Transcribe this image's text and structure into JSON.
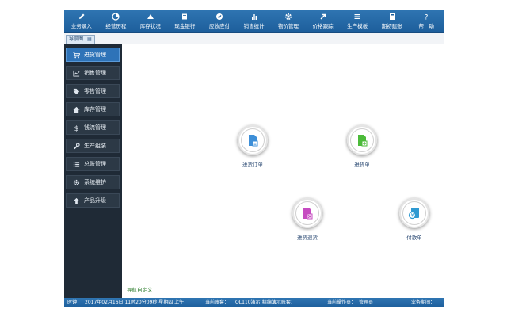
{
  "toolbar": {
    "items": [
      {
        "label": "业务录入",
        "icon": "pencil-icon"
      },
      {
        "label": "经营历程",
        "icon": "pie-chart-icon"
      },
      {
        "label": "库存状况",
        "icon": "cars-icon"
      },
      {
        "label": "现金银行",
        "icon": "book-icon"
      },
      {
        "label": "应收应付",
        "icon": "check-circle-icon"
      },
      {
        "label": "销售统计",
        "icon": "bar-chart-icon"
      },
      {
        "label": "物价管理",
        "icon": "gear-icon"
      },
      {
        "label": "价格跟踪",
        "icon": "arrow-icon"
      },
      {
        "label": "生产模板",
        "icon": "list-icon"
      },
      {
        "label": "期初建账",
        "icon": "calculator-icon"
      },
      {
        "label": "帮　助",
        "icon": "question-icon"
      }
    ]
  },
  "tabs": {
    "nav_label": "导航图"
  },
  "sidebar": {
    "items": [
      {
        "label": "进货管理",
        "icon": "cart-icon"
      },
      {
        "label": "销售管理",
        "icon": "line-chart-icon"
      },
      {
        "label": "零售管理",
        "icon": "tag-icon"
      },
      {
        "label": "库存管理",
        "icon": "home-icon"
      },
      {
        "label": "钱流管理",
        "icon": "dollar-icon"
      },
      {
        "label": "生产组装",
        "icon": "wrench-icon"
      },
      {
        "label": "总账管理",
        "icon": "list-icon"
      },
      {
        "label": "系统维护",
        "icon": "gear-icon"
      },
      {
        "label": "产品升级",
        "icon": "upload-icon"
      }
    ]
  },
  "main": {
    "nodes": [
      {
        "label": "进货订单",
        "icon": "purchase-order-icon"
      },
      {
        "label": "进货单",
        "icon": "purchase-receipt-icon"
      },
      {
        "label": "进货退货",
        "icon": "purchase-return-icon"
      },
      {
        "label": "付款单",
        "icon": "payment-icon"
      }
    ],
    "custom_nav": "导航自定义"
  },
  "status": {
    "time_label": "时钟：",
    "time_value": "2017年02月16日 11时20分09秒 星期四 上午",
    "account_label": "当前账套：",
    "account_value": "OL110演示(精编演示账套)",
    "operator_label": "当前操作员：",
    "operator_value": "管理员",
    "period_label": "业务期间："
  },
  "colors": {
    "toolbar_bg": "#1d5e9b",
    "sidebar_bg": "#1f2a36",
    "sidebar_active": "#2e73b8"
  }
}
